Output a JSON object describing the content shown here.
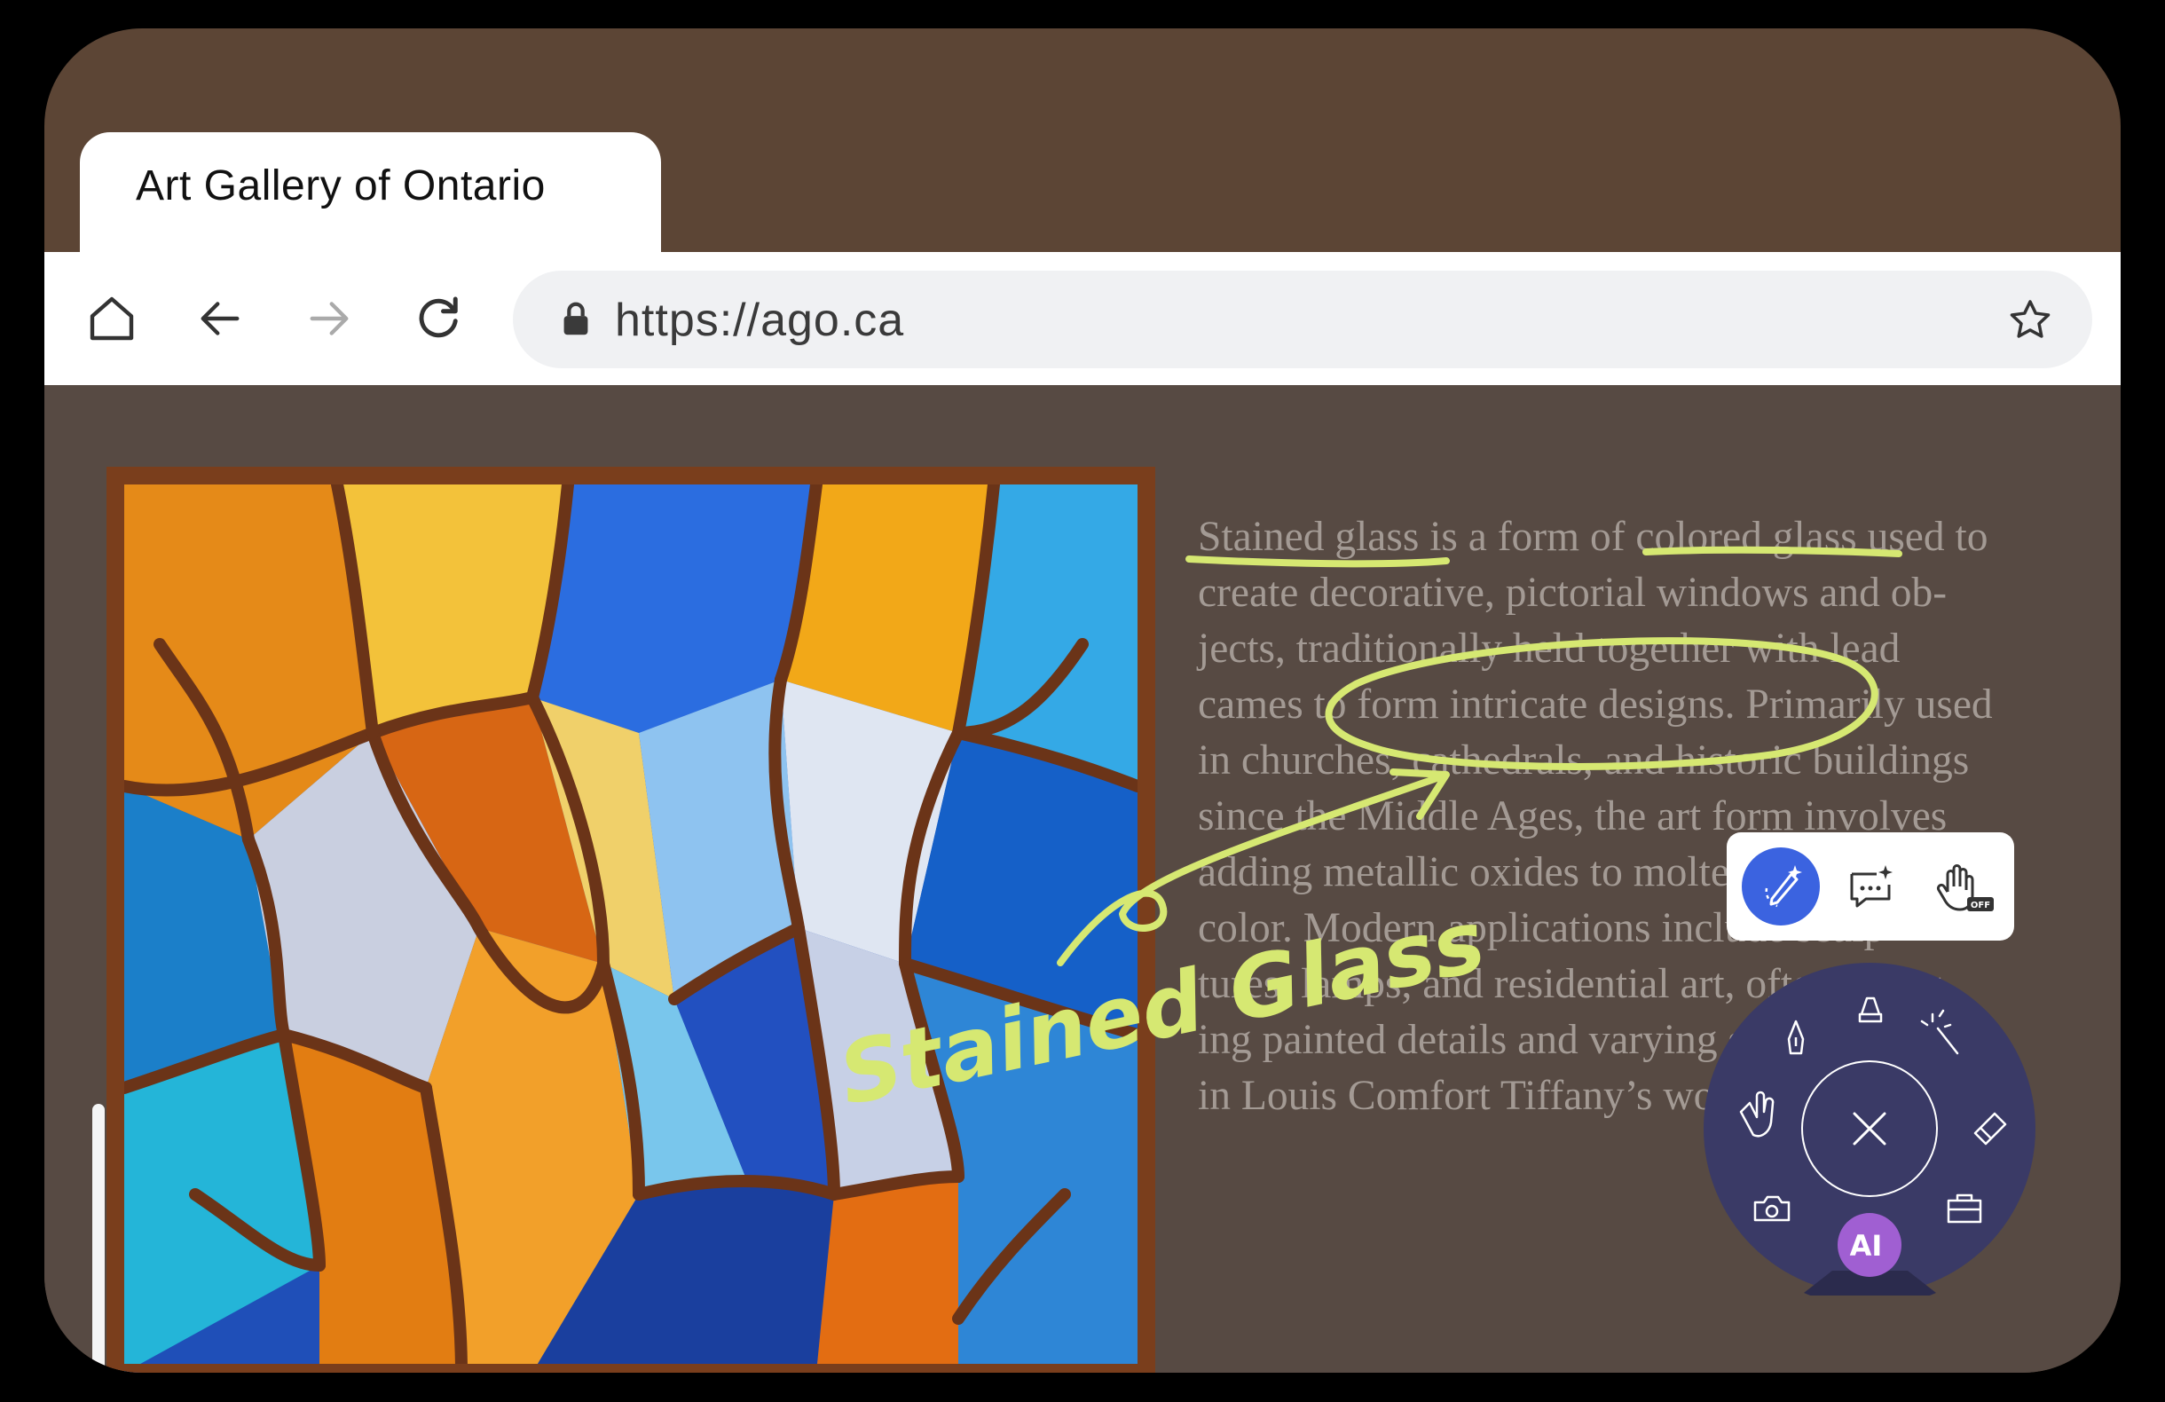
{
  "browser": {
    "tab_title": "Art Gallery of Ontario",
    "url": "https://ago.ca",
    "nav_icons": [
      "home-icon",
      "back-arrow-icon",
      "forward-arrow-icon",
      "reload-icon"
    ],
    "lock_icon": "lock-icon",
    "bookmark_icon": "star-icon"
  },
  "article": {
    "lines": [
      "Stained glass is a form of colored glass used to",
      "create decorative, pictorial windows and ob-",
      "jects, traditionally held together with lead",
      "cames to form intricate designs. Primarily used",
      "in churches, cathedrals, and historic buildings",
      "since the Middle Ages, the art form involves",
      "adding metallic oxides to molten glass for",
      "color. Modern applications include sculp-",
      "tures, lamps, and residential art, often featur-",
      "ing painted details and varying shapes, such as",
      "in Louis Comfort Tiffany’s work."
    ]
  },
  "annotations": {
    "handwritten_note": "Stained Glass",
    "ink_color": "#d6e872"
  },
  "mini_toolbar": {
    "icons": [
      "ai-pen-icon",
      "ai-comment-icon",
      "hand-off-icon"
    ],
    "badge": "OFF",
    "active_color": "#3b63e0"
  },
  "radial_menu": {
    "tools": [
      "marker-icon",
      "pen-icon",
      "magic-wand-icon",
      "hand-icon",
      "eraser-icon",
      "camera-icon",
      "briefcase-icon"
    ],
    "center": "close-icon",
    "ai_button": "AI",
    "background": "#3a3a66",
    "ai_color": "#a05fd2"
  }
}
